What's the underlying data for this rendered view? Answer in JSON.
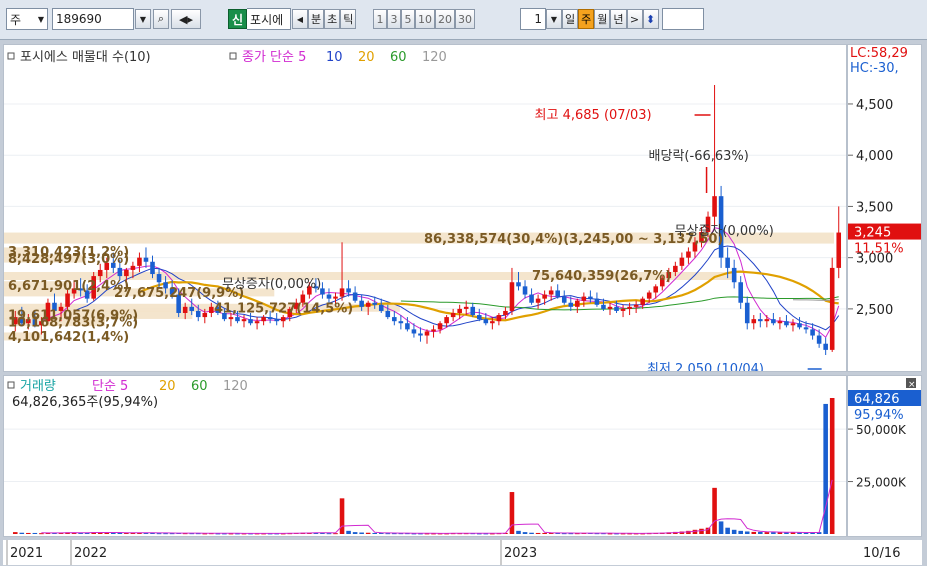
{
  "toolbar": {
    "market": "주",
    "code": "189690",
    "badge": "신",
    "name": "포시에",
    "period_buttons": [
      "분",
      "초",
      "틱"
    ],
    "numbers": [
      "1",
      "3",
      "5",
      "10",
      "20",
      "30"
    ],
    "count": "1",
    "range_buttons": [
      "일",
      "주",
      "월",
      "년"
    ],
    "active_range": "주"
  },
  "price_legend": {
    "title": "포시에스 매물대 수(10)",
    "ma_label": "종가 단순",
    "periods": [
      "5",
      "10",
      "20",
      "60",
      "120"
    ],
    "colors": [
      "#d12ad1",
      "#2143c8",
      "#e0a000",
      "#2a9a2a",
      "#999999"
    ]
  },
  "volume_legend": {
    "title": "거래량",
    "ma_label": "단순",
    "periods": [
      "5",
      "20",
      "60",
      "120"
    ],
    "colors": [
      "#d12ad1",
      "#e0a000",
      "#2a9a2a",
      "#999999"
    ],
    "current": "64,826,365주(95,94%)"
  },
  "price_axis": {
    "lc": "LC:58,29",
    "hc": "HC:-30,",
    "ticks": [
      "4,500",
      "4,000",
      "3,500",
      "3,000",
      "2,500"
    ],
    "current_price": "3,245",
    "current_change": "11,51%"
  },
  "volume_axis": {
    "current_volume": "64,826",
    "current_pct": "95,94%",
    "ticks": [
      "50,000K",
      "25,000K"
    ]
  },
  "date_axis": {
    "labels": [
      "2021",
      "2022",
      "2023",
      "10/16"
    ]
  },
  "annotations": {
    "high": "최고 4,685 (07/03)",
    "low": "최저 2,050 (10/04)",
    "dividend": "배당락(-66,63%)",
    "bonus": "무상증자(0,00%)",
    "bonus_left": "무상증자(0,00%)",
    "dividend_left": "배당락(-66,63%)"
  },
  "volume_profile": [
    {
      "label": "86,338,574(30,4%)(3,245,00 ~ 3,137,50)",
      "price_lo": 3137.5,
      "price_hi": 3245,
      "pct": 30.4
    },
    {
      "label": "75,640,359(26,7%)",
      "price_lo": 2800,
      "price_hi": 2860,
      "pct": 26.7
    },
    {
      "label": "3,310,423(1,2%)",
      "price_lo": 3030,
      "price_hi": 3100,
      "pct": 1.2
    },
    {
      "label": "8,428,497(3,0%)",
      "price_lo": 2960,
      "price_hi": 3030,
      "pct": 3.0
    },
    {
      "label": "6,671,901(2,4%)",
      "price_lo": 2700,
      "price_hi": 2770,
      "pct": 2.4
    },
    {
      "label": "27,675,247(9,9%)",
      "price_lo": 2630,
      "price_hi": 2700,
      "pct": 9.9
    },
    {
      "label": "41,125,727(14,5%)",
      "price_lo": 2480,
      "price_hi": 2550,
      "pct": 14.5
    },
    {
      "label": "19,611,057(6,9%)",
      "price_lo": 2410,
      "price_hi": 2480,
      "pct": 6.9
    },
    {
      "label": "10,168,783(3,7%)",
      "price_lo": 2340,
      "price_hi": 2410,
      "pct": 3.7
    },
    {
      "label": "4,101,642(1,4%)",
      "price_lo": 2200,
      "price_hi": 2270,
      "pct": 1.4
    }
  ],
  "chart_data": {
    "type": "candlestick",
    "title": "포시에스 매물대 수(10)",
    "price_ylim": [
      2050,
      4700
    ],
    "high": 4685,
    "low": 2050,
    "last": 3245,
    "series": [
      {
        "name": "candles",
        "note": "weekly OHLC (approximate, index 0..139)",
        "ohlc": [
          [
            2350,
            2480,
            2280,
            2420
          ],
          [
            2420,
            2520,
            2330,
            2360
          ],
          [
            2360,
            2450,
            2300,
            2400
          ],
          [
            2400,
            2480,
            2320,
            2340
          ],
          [
            2340,
            2420,
            2250,
            2380
          ],
          [
            2380,
            2600,
            2350,
            2560
          ],
          [
            2560,
            2650,
            2450,
            2480
          ],
          [
            2480,
            2560,
            2380,
            2520
          ],
          [
            2520,
            2700,
            2480,
            2650
          ],
          [
            2650,
            2780,
            2600,
            2700
          ],
          [
            2700,
            2800,
            2620,
            2680
          ],
          [
            2680,
            2740,
            2560,
            2600
          ],
          [
            2600,
            2860,
            2580,
            2820
          ],
          [
            2820,
            2940,
            2760,
            2880
          ],
          [
            2880,
            3000,
            2800,
            2950
          ],
          [
            2950,
            3050,
            2850,
            2900
          ],
          [
            2900,
            2980,
            2780,
            2820
          ],
          [
            2820,
            2900,
            2720,
            2880
          ],
          [
            2880,
            2960,
            2800,
            2920
          ],
          [
            2920,
            3050,
            2860,
            3000
          ],
          [
            3000,
            3100,
            2900,
            2960
          ],
          [
            2960,
            3020,
            2800,
            2840
          ],
          [
            2840,
            2900,
            2700,
            2760
          ],
          [
            2760,
            2820,
            2650,
            2700
          ],
          [
            2700,
            2780,
            2600,
            2640
          ],
          [
            2640,
            2700,
            2420,
            2460
          ],
          [
            2460,
            2560,
            2400,
            2520
          ],
          [
            2520,
            2600,
            2440,
            2480
          ],
          [
            2480,
            2540,
            2380,
            2420
          ],
          [
            2420,
            2500,
            2360,
            2460
          ],
          [
            2460,
            2560,
            2420,
            2520
          ],
          [
            2520,
            2580,
            2440,
            2460
          ],
          [
            2460,
            2500,
            2380,
            2400
          ],
          [
            2400,
            2460,
            2330,
            2420
          ],
          [
            2420,
            2480,
            2360,
            2380
          ],
          [
            2380,
            2440,
            2320,
            2400
          ],
          [
            2400,
            2460,
            2340,
            2360
          ],
          [
            2360,
            2420,
            2300,
            2380
          ],
          [
            2380,
            2440,
            2340,
            2420
          ],
          [
            2420,
            2480,
            2360,
            2400
          ],
          [
            2400,
            2460,
            2340,
            2380
          ],
          [
            2380,
            2440,
            2320,
            2420
          ],
          [
            2420,
            2520,
            2380,
            2500
          ],
          [
            2500,
            2600,
            2460,
            2560
          ],
          [
            2560,
            2680,
            2520,
            2640
          ],
          [
            2640,
            2760,
            2600,
            2720
          ],
          [
            2720,
            2800,
            2660,
            2700
          ],
          [
            2700,
            2760,
            2600,
            2640
          ],
          [
            2640,
            2700,
            2560,
            2600
          ],
          [
            2600,
            2660,
            2540,
            2620
          ],
          [
            2620,
            3150,
            2580,
            2700
          ],
          [
            2700,
            2780,
            2620,
            2660
          ],
          [
            2660,
            2720,
            2560,
            2580
          ],
          [
            2580,
            2640,
            2480,
            2520
          ],
          [
            2520,
            2580,
            2440,
            2560
          ],
          [
            2560,
            2620,
            2500,
            2540
          ],
          [
            2540,
            2600,
            2460,
            2480
          ],
          [
            2480,
            2540,
            2400,
            2420
          ],
          [
            2420,
            2480,
            2340,
            2380
          ],
          [
            2380,
            2440,
            2300,
            2360
          ],
          [
            2360,
            2420,
            2280,
            2300
          ],
          [
            2300,
            2360,
            2220,
            2260
          ],
          [
            2260,
            2320,
            2180,
            2240
          ],
          [
            2240,
            2300,
            2160,
            2280
          ],
          [
            2280,
            2340,
            2220,
            2300
          ],
          [
            2300,
            2380,
            2260,
            2360
          ],
          [
            2360,
            2440,
            2320,
            2420
          ],
          [
            2420,
            2500,
            2380,
            2460
          ],
          [
            2460,
            2540,
            2400,
            2500
          ],
          [
            2500,
            2580,
            2440,
            2520
          ],
          [
            2520,
            2560,
            2420,
            2440
          ],
          [
            2440,
            2500,
            2380,
            2400
          ],
          [
            2400,
            2460,
            2340,
            2360
          ],
          [
            2360,
            2420,
            2300,
            2380
          ],
          [
            2380,
            2460,
            2340,
            2440
          ],
          [
            2440,
            2520,
            2400,
            2480
          ],
          [
            2480,
            2900,
            2440,
            2760
          ],
          [
            2760,
            2860,
            2680,
            2720
          ],
          [
            2720,
            2780,
            2600,
            2640
          ],
          [
            2640,
            2700,
            2540,
            2560
          ],
          [
            2560,
            2640,
            2500,
            2600
          ],
          [
            2600,
            2680,
            2540,
            2640
          ],
          [
            2640,
            2720,
            2580,
            2680
          ],
          [
            2680,
            2740,
            2600,
            2620
          ],
          [
            2620,
            2680,
            2540,
            2560
          ],
          [
            2560,
            2620,
            2480,
            2520
          ],
          [
            2520,
            2600,
            2460,
            2580
          ],
          [
            2580,
            2660,
            2520,
            2620
          ],
          [
            2620,
            2680,
            2560,
            2600
          ],
          [
            2600,
            2660,
            2520,
            2540
          ],
          [
            2540,
            2600,
            2480,
            2500
          ],
          [
            2500,
            2560,
            2440,
            2520
          ],
          [
            2520,
            2580,
            2460,
            2480
          ],
          [
            2480,
            2540,
            2420,
            2500
          ],
          [
            2500,
            2560,
            2440,
            2520
          ],
          [
            2520,
            2580,
            2460,
            2540
          ],
          [
            2540,
            2620,
            2500,
            2600
          ],
          [
            2600,
            2680,
            2560,
            2660
          ],
          [
            2660,
            2740,
            2600,
            2720
          ],
          [
            2720,
            2820,
            2680,
            2800
          ],
          [
            2800,
            2900,
            2760,
            2860
          ],
          [
            2860,
            2960,
            2820,
            2920
          ],
          [
            2920,
            3050,
            2880,
            3000
          ],
          [
            3000,
            3100,
            2940,
            3060
          ],
          [
            3060,
            3200,
            3000,
            3150
          ],
          [
            3150,
            3300,
            3100,
            3250
          ],
          [
            3250,
            3450,
            3200,
            3400
          ],
          [
            3400,
            4685,
            3300,
            3600
          ],
          [
            3600,
            3700,
            2900,
            3000
          ],
          [
            3000,
            3100,
            2800,
            2900
          ],
          [
            2900,
            2980,
            2700,
            2760
          ],
          [
            2760,
            2820,
            2500,
            2560
          ],
          [
            2560,
            2620,
            2300,
            2360
          ],
          [
            2360,
            2440,
            2300,
            2400
          ],
          [
            2400,
            2460,
            2320,
            2380
          ],
          [
            2380,
            2440,
            2320,
            2400
          ],
          [
            2400,
            2460,
            2340,
            2360
          ],
          [
            2360,
            2420,
            2300,
            2380
          ],
          [
            2380,
            2440,
            2320,
            2340
          ],
          [
            2340,
            2400,
            2280,
            2360
          ],
          [
            2360,
            2420,
            2300,
            2320
          ],
          [
            2320,
            2380,
            2260,
            2300
          ],
          [
            2300,
            2360,
            2200,
            2240
          ],
          [
            2240,
            2300,
            2120,
            2160
          ],
          [
            2160,
            2220,
            2050,
            2100
          ],
          [
            2100,
            3000,
            2080,
            2900
          ],
          [
            2900,
            3500,
            2800,
            3245
          ]
        ]
      },
      {
        "name": "volume",
        "note": "weekly volume in K (approximate)",
        "values": [
          900,
          600,
          500,
          500,
          400,
          700,
          600,
          500,
          800,
          700,
          600,
          500,
          900,
          800,
          700,
          600,
          500,
          500,
          500,
          700,
          600,
          500,
          400,
          400,
          400,
          500,
          400,
          400,
          400,
          300,
          400,
          300,
          300,
          300,
          300,
          300,
          300,
          300,
          300,
          300,
          300,
          300,
          400,
          500,
          600,
          700,
          600,
          500,
          400,
          400,
          17000,
          1500,
          900,
          700,
          600,
          500,
          500,
          400,
          400,
          400,
          400,
          300,
          300,
          300,
          300,
          300,
          300,
          400,
          400,
          400,
          400,
          300,
          300,
          300,
          400,
          500,
          20000,
          1500,
          900,
          600,
          500,
          500,
          500,
          500,
          400,
          400,
          400,
          500,
          500,
          400,
          400,
          300,
          300,
          300,
          300,
          300,
          300,
          400,
          500,
          600,
          800,
          1000,
          1200,
          1500,
          2000,
          2500,
          3000,
          22000,
          6000,
          3000,
          2000,
          1500,
          1200,
          1000,
          1000,
          900,
          900,
          800,
          800,
          700,
          700,
          600,
          700,
          900,
          62000,
          64826
        ]
      }
    ]
  }
}
